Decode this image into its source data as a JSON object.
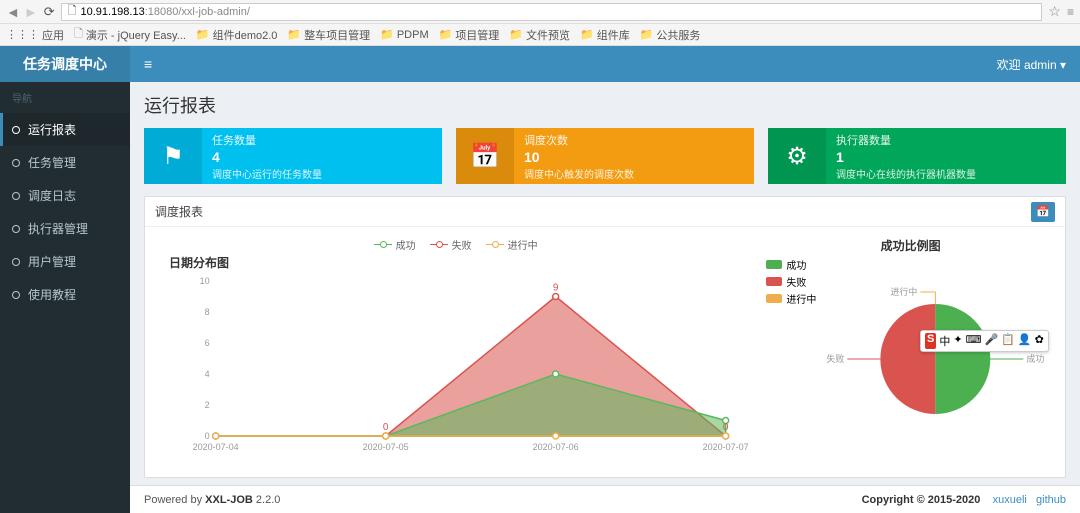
{
  "browser": {
    "url_host": "10.91.198.13",
    "url_port": ":18080",
    "url_path": "/xxl-job-admin/",
    "bookmarks_label": "应用",
    "bookmarks": [
      "演示 - jQuery Easy...",
      "组件demo2.0",
      "整车项目管理",
      "PDPM",
      "项目管理",
      "文件预览",
      "组件库",
      "公共服务"
    ]
  },
  "sidebar": {
    "logo": "任务调度中心",
    "nav_header": "导航",
    "items": [
      {
        "label": "运行报表"
      },
      {
        "label": "任务管理"
      },
      {
        "label": "调度日志"
      },
      {
        "label": "执行器管理"
      },
      {
        "label": "用户管理"
      },
      {
        "label": "使用教程"
      }
    ]
  },
  "header": {
    "welcome": "欢迎 admin ▾"
  },
  "page": {
    "title": "运行报表"
  },
  "cards": [
    {
      "label": "任务数量",
      "value": "4",
      "desc": "调度中心运行的任务数量",
      "icon": "⚑"
    },
    {
      "label": "调度次数",
      "value": "10",
      "desc": "调度中心触发的调度次数",
      "icon": "📅"
    },
    {
      "label": "执行器数量",
      "value": "1",
      "desc": "调度中心在线的执行器机器数量",
      "icon": "⚙"
    }
  ],
  "report": {
    "title": "调度报表",
    "line_title": "日期分布图",
    "pie_title": "成功比例图",
    "legend": {
      "success": "成功",
      "fail": "失败",
      "running": "进行中"
    }
  },
  "chart_data": [
    {
      "type": "line",
      "title": "日期分布图",
      "categories": [
        "2020-07-04",
        "2020-07-05",
        "2020-07-06",
        "2020-07-07"
      ],
      "series": [
        {
          "name": "成功",
          "values": [
            0,
            0,
            4,
            1
          ],
          "color": "#5cb85c"
        },
        {
          "name": "失败",
          "values": [
            0,
            0,
            9,
            0
          ],
          "color": "#d9534f"
        },
        {
          "name": "进行中",
          "values": [
            0,
            0,
            0,
            0
          ],
          "color": "#f0ad4e"
        }
      ],
      "ylim": [
        0,
        10
      ],
      "yticks": [
        0,
        2,
        4,
        6,
        8,
        10
      ]
    },
    {
      "type": "pie",
      "title": "成功比例图",
      "series": [
        {
          "name": "成功",
          "value": 5,
          "color": "#4caf50"
        },
        {
          "name": "失败",
          "value": 5,
          "color": "#d9534f"
        },
        {
          "name": "进行中",
          "value": 0,
          "color": "#f0ad4e"
        }
      ]
    }
  ],
  "footer": {
    "powered": "Powered by ",
    "product": "XXL-JOB",
    "version": " 2.2.0",
    "copyright": "Copyright © 2015-2020 ",
    "author": "xuxueli",
    "github": "github"
  },
  "ime": {
    "label": "中"
  }
}
